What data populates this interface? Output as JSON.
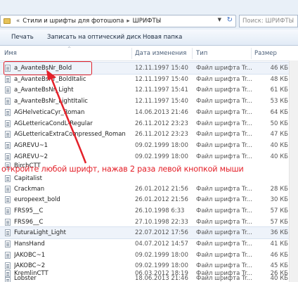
{
  "address": {
    "path": [
      "Стили и шрифты для фотошопа",
      "ШРИФТЫ"
    ],
    "search_placeholder": "Поиск: ШРИФТЫ"
  },
  "toolbar": {
    "print": "Печать",
    "burn": "Записать на оптический диск",
    "new_folder": "Новая папка"
  },
  "columns": {
    "name": "Имя",
    "date": "Дата изменения",
    "type": "Тип",
    "size": "Размер"
  },
  "files": [
    {
      "name": "a_AvanteBsNr_Bold",
      "date": "12.11.1997 15:40",
      "type": "Файл шрифта Tr...",
      "size": "46 КБ"
    },
    {
      "name": "a_AvanteBsNr_BoldItalic",
      "date": "12.11.1997 15:40",
      "type": "Файл шрифта Tr...",
      "size": "48 КБ"
    },
    {
      "name": "a_AvanteBsNr_Light",
      "date": "12.11.1997 15:41",
      "type": "Файл шрифта Tr...",
      "size": "61 КБ"
    },
    {
      "name": "a_AvanteBsNr_LightItalic",
      "date": "12.11.1997 15:40",
      "type": "Файл шрифта Tr...",
      "size": "53 КБ"
    },
    {
      "name": "AGHelveticaCyr_Roman",
      "date": "14.06.2013 21:46",
      "type": "Файл шрифта Tr...",
      "size": "64 КБ"
    },
    {
      "name": "AGLettericaCondL-Regular",
      "date": "26.11.2012 23:23",
      "type": "Файл шрифта Tr...",
      "size": "50 КБ"
    },
    {
      "name": "AGLettericaExtraCompressed_Roman",
      "date": "26.11.2012 23:23",
      "type": "Файл шрифта Tr...",
      "size": "47 КБ"
    },
    {
      "name": "AGREVU~1",
      "date": "09.02.1999 18:00",
      "type": "Файл шрифта Tr...",
      "size": "40 КБ"
    },
    {
      "name": "AGREVU~2",
      "date": "09.02.1999 18:00",
      "type": "Файл шрифта Tr...",
      "size": "40 КБ"
    },
    {
      "name": "BirchCTT",
      "date": "",
      "type": "",
      "size": ""
    },
    {
      "name": "Capitalist",
      "date": "",
      "type": "",
      "size": ""
    },
    {
      "name": "Crackman",
      "date": "26.01.2012 21:56",
      "type": "Файл шрифта Tr...",
      "size": "28 КБ"
    },
    {
      "name": "europeext_bold",
      "date": "26.01.2012 21:56",
      "type": "Файл шрифта Tr...",
      "size": "30 КБ"
    },
    {
      "name": "FRS95__C",
      "date": "26.10.1998 6:33",
      "type": "Файл шрифта Tr...",
      "size": "57 КБ"
    },
    {
      "name": "FRS96__C",
      "date": "27.10.1998 22:33",
      "type": "Файл шрифта Tr...",
      "size": "57 КБ"
    },
    {
      "name": "FuturaLight_Light",
      "date": "22.07.2012 17:56",
      "type": "Файл шрифта Tr...",
      "size": "36 КБ"
    },
    {
      "name": "HansHand",
      "date": "04.07.2012 14:57",
      "type": "Файл шрифта Tr...",
      "size": "41 КБ"
    },
    {
      "name": "JAKOBC~1",
      "date": "09.02.1999 18:00",
      "type": "Файл шрифта Tr...",
      "size": "46 КБ"
    },
    {
      "name": "JAKOBC~2",
      "date": "09.02.1999 18:00",
      "type": "Файл шрифта Tr...",
      "size": "45 КБ"
    },
    {
      "name": "KremlinCTT",
      "date": "06.03.2012 18:19",
      "type": "Файл шрифта Tr...",
      "size": "26 КБ"
    },
    {
      "name": "Lobster",
      "date": "18.06.2013 21:46",
      "type": "Файл шрифта Tr...",
      "size": "40 КБ"
    }
  ],
  "annotation": "откройте любой  шрифт, нажав 2 раза левой кнопкой мыши",
  "colors": {
    "annotation": "#e4212a"
  },
  "icons": [
    "folder-icon",
    "font-file-icon"
  ]
}
